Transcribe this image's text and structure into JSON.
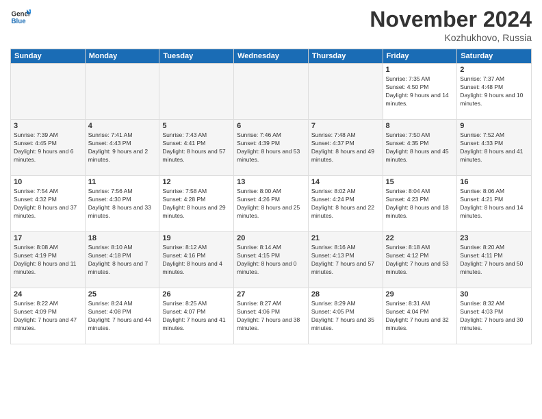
{
  "header": {
    "logo_line1": "General",
    "logo_line2": "Blue",
    "month_title": "November 2024",
    "location": "Kozhukhovo, Russia"
  },
  "weekdays": [
    "Sunday",
    "Monday",
    "Tuesday",
    "Wednesday",
    "Thursday",
    "Friday",
    "Saturday"
  ],
  "weeks": [
    [
      {
        "day": "",
        "sunrise": "",
        "sunset": "",
        "daylight": ""
      },
      {
        "day": "",
        "sunrise": "",
        "sunset": "",
        "daylight": ""
      },
      {
        "day": "",
        "sunrise": "",
        "sunset": "",
        "daylight": ""
      },
      {
        "day": "",
        "sunrise": "",
        "sunset": "",
        "daylight": ""
      },
      {
        "day": "",
        "sunrise": "",
        "sunset": "",
        "daylight": ""
      },
      {
        "day": "1",
        "sunrise": "Sunrise: 7:35 AM",
        "sunset": "Sunset: 4:50 PM",
        "daylight": "Daylight: 9 hours and 14 minutes."
      },
      {
        "day": "2",
        "sunrise": "Sunrise: 7:37 AM",
        "sunset": "Sunset: 4:48 PM",
        "daylight": "Daylight: 9 hours and 10 minutes."
      }
    ],
    [
      {
        "day": "3",
        "sunrise": "Sunrise: 7:39 AM",
        "sunset": "Sunset: 4:45 PM",
        "daylight": "Daylight: 9 hours and 6 minutes."
      },
      {
        "day": "4",
        "sunrise": "Sunrise: 7:41 AM",
        "sunset": "Sunset: 4:43 PM",
        "daylight": "Daylight: 9 hours and 2 minutes."
      },
      {
        "day": "5",
        "sunrise": "Sunrise: 7:43 AM",
        "sunset": "Sunset: 4:41 PM",
        "daylight": "Daylight: 8 hours and 57 minutes."
      },
      {
        "day": "6",
        "sunrise": "Sunrise: 7:46 AM",
        "sunset": "Sunset: 4:39 PM",
        "daylight": "Daylight: 8 hours and 53 minutes."
      },
      {
        "day": "7",
        "sunrise": "Sunrise: 7:48 AM",
        "sunset": "Sunset: 4:37 PM",
        "daylight": "Daylight: 8 hours and 49 minutes."
      },
      {
        "day": "8",
        "sunrise": "Sunrise: 7:50 AM",
        "sunset": "Sunset: 4:35 PM",
        "daylight": "Daylight: 8 hours and 45 minutes."
      },
      {
        "day": "9",
        "sunrise": "Sunrise: 7:52 AM",
        "sunset": "Sunset: 4:33 PM",
        "daylight": "Daylight: 8 hours and 41 minutes."
      }
    ],
    [
      {
        "day": "10",
        "sunrise": "Sunrise: 7:54 AM",
        "sunset": "Sunset: 4:32 PM",
        "daylight": "Daylight: 8 hours and 37 minutes."
      },
      {
        "day": "11",
        "sunrise": "Sunrise: 7:56 AM",
        "sunset": "Sunset: 4:30 PM",
        "daylight": "Daylight: 8 hours and 33 minutes."
      },
      {
        "day": "12",
        "sunrise": "Sunrise: 7:58 AM",
        "sunset": "Sunset: 4:28 PM",
        "daylight": "Daylight: 8 hours and 29 minutes."
      },
      {
        "day": "13",
        "sunrise": "Sunrise: 8:00 AM",
        "sunset": "Sunset: 4:26 PM",
        "daylight": "Daylight: 8 hours and 25 minutes."
      },
      {
        "day": "14",
        "sunrise": "Sunrise: 8:02 AM",
        "sunset": "Sunset: 4:24 PM",
        "daylight": "Daylight: 8 hours and 22 minutes."
      },
      {
        "day": "15",
        "sunrise": "Sunrise: 8:04 AM",
        "sunset": "Sunset: 4:23 PM",
        "daylight": "Daylight: 8 hours and 18 minutes."
      },
      {
        "day": "16",
        "sunrise": "Sunrise: 8:06 AM",
        "sunset": "Sunset: 4:21 PM",
        "daylight": "Daylight: 8 hours and 14 minutes."
      }
    ],
    [
      {
        "day": "17",
        "sunrise": "Sunrise: 8:08 AM",
        "sunset": "Sunset: 4:19 PM",
        "daylight": "Daylight: 8 hours and 11 minutes."
      },
      {
        "day": "18",
        "sunrise": "Sunrise: 8:10 AM",
        "sunset": "Sunset: 4:18 PM",
        "daylight": "Daylight: 8 hours and 7 minutes."
      },
      {
        "day": "19",
        "sunrise": "Sunrise: 8:12 AM",
        "sunset": "Sunset: 4:16 PM",
        "daylight": "Daylight: 8 hours and 4 minutes."
      },
      {
        "day": "20",
        "sunrise": "Sunrise: 8:14 AM",
        "sunset": "Sunset: 4:15 PM",
        "daylight": "Daylight: 8 hours and 0 minutes."
      },
      {
        "day": "21",
        "sunrise": "Sunrise: 8:16 AM",
        "sunset": "Sunset: 4:13 PM",
        "daylight": "Daylight: 7 hours and 57 minutes."
      },
      {
        "day": "22",
        "sunrise": "Sunrise: 8:18 AM",
        "sunset": "Sunset: 4:12 PM",
        "daylight": "Daylight: 7 hours and 53 minutes."
      },
      {
        "day": "23",
        "sunrise": "Sunrise: 8:20 AM",
        "sunset": "Sunset: 4:11 PM",
        "daylight": "Daylight: 7 hours and 50 minutes."
      }
    ],
    [
      {
        "day": "24",
        "sunrise": "Sunrise: 8:22 AM",
        "sunset": "Sunset: 4:09 PM",
        "daylight": "Daylight: 7 hours and 47 minutes."
      },
      {
        "day": "25",
        "sunrise": "Sunrise: 8:24 AM",
        "sunset": "Sunset: 4:08 PM",
        "daylight": "Daylight: 7 hours and 44 minutes."
      },
      {
        "day": "26",
        "sunrise": "Sunrise: 8:25 AM",
        "sunset": "Sunset: 4:07 PM",
        "daylight": "Daylight: 7 hours and 41 minutes."
      },
      {
        "day": "27",
        "sunrise": "Sunrise: 8:27 AM",
        "sunset": "Sunset: 4:06 PM",
        "daylight": "Daylight: 7 hours and 38 minutes."
      },
      {
        "day": "28",
        "sunrise": "Sunrise: 8:29 AM",
        "sunset": "Sunset: 4:05 PM",
        "daylight": "Daylight: 7 hours and 35 minutes."
      },
      {
        "day": "29",
        "sunrise": "Sunrise: 8:31 AM",
        "sunset": "Sunset: 4:04 PM",
        "daylight": "Daylight: 7 hours and 32 minutes."
      },
      {
        "day": "30",
        "sunrise": "Sunrise: 8:32 AM",
        "sunset": "Sunset: 4:03 PM",
        "daylight": "Daylight: 7 hours and 30 minutes."
      }
    ]
  ]
}
